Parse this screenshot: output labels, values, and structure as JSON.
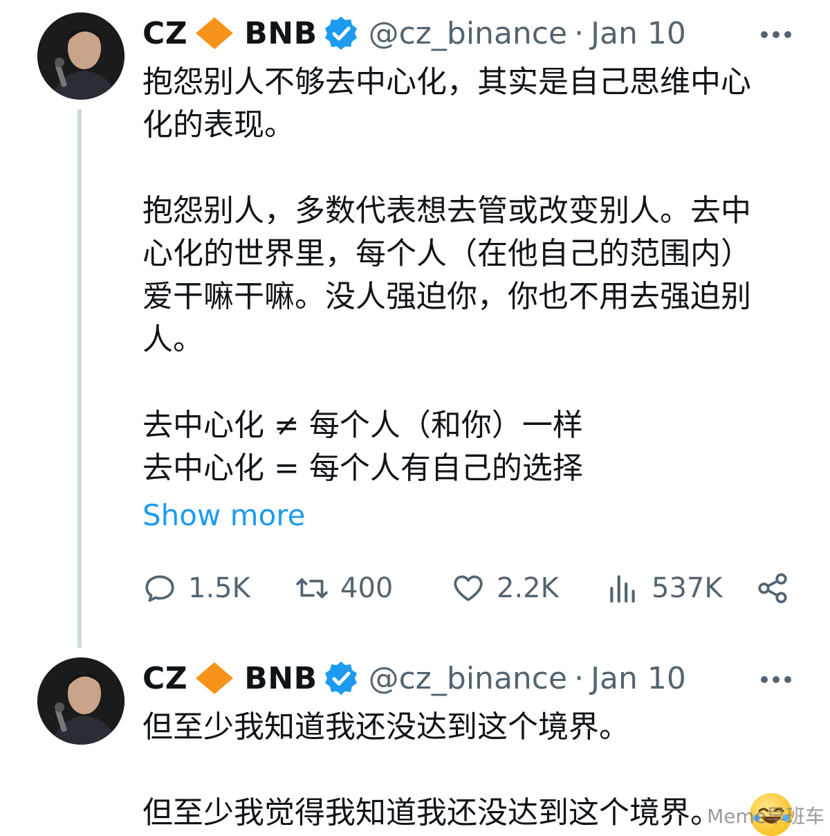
{
  "tweet1": {
    "display_name": "CZ",
    "name_suffix": "BNB",
    "handle": "@cz_binance",
    "separator": "·",
    "date": "Jan 10",
    "body": "抱怨别人不够去中心化，其实是自己思维中心\n化的表现。\n\n抱怨别人，多数代表想去管或改变别人。去中\n心化的世界里，每个人（在他自己的范围内）\n爱干嘛干嘛。没人强迫你，你也不用去强迫别\n人。\n\n去中心化 ≠ 每个人（和你）一样\n去中心化 = 每个人有自己的选择",
    "show_more": "Show more",
    "stats": {
      "replies": "1.5K",
      "retweets": "400",
      "likes": "2.2K",
      "views": "537K"
    }
  },
  "tweet2": {
    "display_name": "CZ",
    "name_suffix": "BNB",
    "handle": "@cz_binance",
    "separator": "·",
    "date": "Jan 10",
    "body": "但至少我知道我还没达到这个境界。\n\n但至少我觉得我知道我还没达到这个境界。"
  },
  "watermark": "Meme早班车",
  "colors": {
    "link": "#1d9bf0",
    "verified": "#1d9bf0",
    "diamond": "#f7931a",
    "muted": "#536471",
    "thread_line": "#cfd9de"
  },
  "icons": [
    "diamond-icon",
    "verified-badge-icon",
    "more-icon",
    "reply-icon",
    "retweet-icon",
    "like-icon",
    "views-icon",
    "share-icon",
    "laughing-emoji-icon"
  ]
}
